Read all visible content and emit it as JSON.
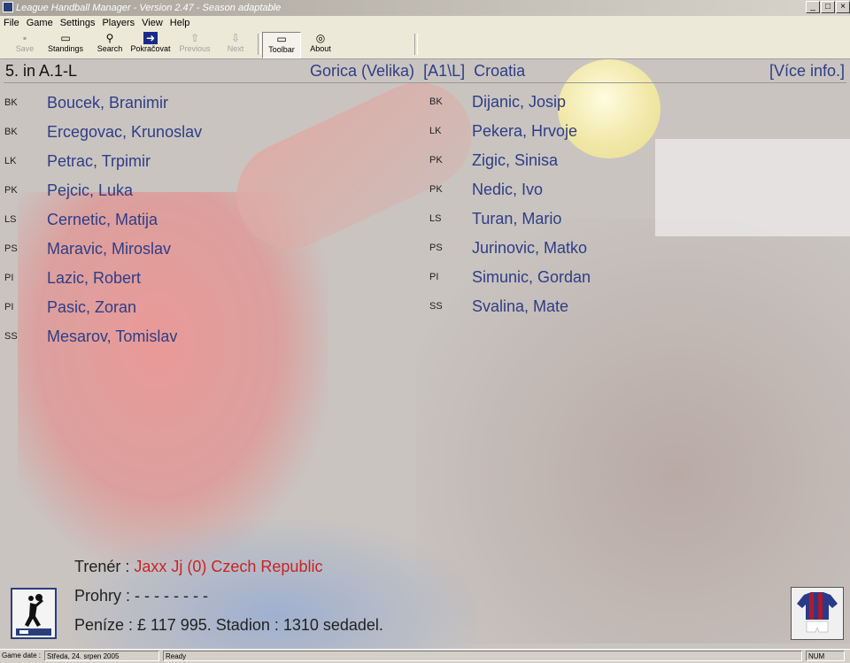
{
  "window": {
    "title": "League Handball Manager - Version 2.47 - Season adaptable",
    "minimize": "_",
    "maximize": "□",
    "close": "×"
  },
  "menu": [
    "File",
    "Game",
    "Settings",
    "Players",
    "View",
    "Help"
  ],
  "toolbar": {
    "save": "Save",
    "standings": "Standings",
    "search": "Search",
    "continue": "Pokračovat",
    "previous": "Previous",
    "next": "Next",
    "toolbar": "Toolbar",
    "about": "About"
  },
  "info": {
    "rank": "5. in A.1-L",
    "team": "Gorica (Velika)",
    "league": "[A1\\L]",
    "country": "Croatia",
    "more": "[Více info.]"
  },
  "players_left": [
    {
      "pos": "BK",
      "name": "Boucek, Branimir"
    },
    {
      "pos": "BK",
      "name": "Ercegovac, Krunoslav"
    },
    {
      "pos": "LK",
      "name": "Petrac, Trpimir"
    },
    {
      "pos": "PK",
      "name": "Pejcic, Luka"
    },
    {
      "pos": "LS",
      "name": "Cernetic, Matija"
    },
    {
      "pos": "PS",
      "name": "Maravic, Miroslav"
    },
    {
      "pos": "PI",
      "name": "Lazic, Robert"
    },
    {
      "pos": "PI",
      "name": "Pasic, Zoran"
    },
    {
      "pos": "SS",
      "name": "Mesarov, Tomislav"
    }
  ],
  "players_right": [
    {
      "pos": "BK",
      "name": "Dijanic, Josip"
    },
    {
      "pos": "LK",
      "name": "Pekera, Hrvoje"
    },
    {
      "pos": "PK",
      "name": "Zigic, Sinisa"
    },
    {
      "pos": "PK",
      "name": "Nedic, Ivo"
    },
    {
      "pos": "LS",
      "name": "Turan, Mario"
    },
    {
      "pos": "PS",
      "name": "Jurinovic, Matko"
    },
    {
      "pos": "PI",
      "name": "Simunic, Gordan"
    },
    {
      "pos": "SS",
      "name": "Svalina, Mate"
    }
  ],
  "footer": {
    "coach_label": "Trenér :",
    "coach_value": "Jaxx Jj (0) Czech Republic",
    "losses_label": "Prohry :",
    "losses_value": "- - - - - - - -",
    "money_text": "Peníze : £ 117 995.  Stadion : 1310 sedadel."
  },
  "status": {
    "game_date_label": "Game date :",
    "game_date": "Středa, 24. srpen 2005",
    "state": "Ready",
    "num": "NUM"
  },
  "colors": {
    "accent": "#2f3d86",
    "coach": "#cc2222"
  }
}
